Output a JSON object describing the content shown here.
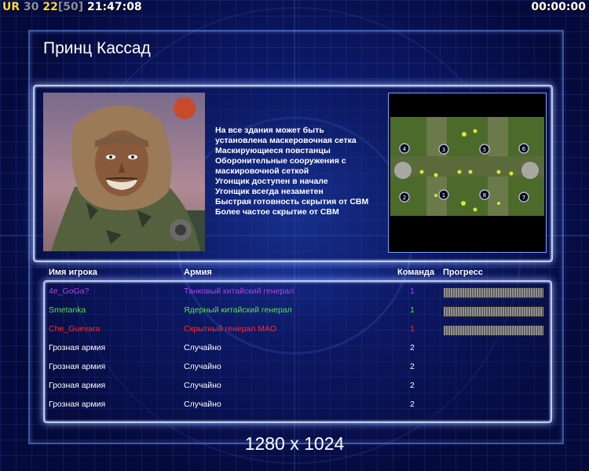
{
  "hud": {
    "tag": "UR",
    "value1": "30",
    "value2": "22",
    "value3": "[50]",
    "clock": "21:47:08",
    "timer": "00:00:00"
  },
  "title": "Принц Кассад",
  "description": [
    "На все здания может быть",
    " установлена маскеровочная сетка",
    "Маскирующиеся повстанцы",
    "Оборонительные сооружения с",
    " маскировочной сеткой",
    "Угонщик доступен в начале",
    "Угонщик всегда незаметен",
    "Быстрая готовность скрытия от СВМ",
    "Более частое скрытие от СВМ"
  ],
  "table": {
    "headers": {
      "player": "Имя игрока",
      "army": "Армия",
      "team": "Команда",
      "progress": "Прогресс"
    },
    "rows": [
      {
        "player": "4e_GoGa?",
        "army": "Танковый китайский генерал",
        "team": "1",
        "color": "#b040e8",
        "progress": 1
      },
      {
        "player": "Smetanka",
        "army": "Ядерный китайский генерал",
        "team": "1",
        "color": "#59e04a",
        "progress": 1
      },
      {
        "player": "Che_Guevara",
        "army": "Скрытный генерал МАО",
        "team": "1",
        "color": "#ff2a2a",
        "progress": 1
      },
      {
        "player": "Грозная армия",
        "army": "Случайно",
        "team": "2",
        "color": "#ffffff",
        "progress": null
      },
      {
        "player": "Грозная армия",
        "army": "Случайно",
        "team": "2",
        "color": "#ffffff",
        "progress": null
      },
      {
        "player": "Грозная армия",
        "army": "Случайно",
        "team": "2",
        "color": "#ffffff",
        "progress": null
      },
      {
        "player": "Грозная армия",
        "army": "Случайно",
        "team": "2",
        "color": "#ffffff",
        "progress": null
      }
    ]
  },
  "minimap": {
    "start_positions": [
      "1",
      "2",
      "3",
      "4",
      "5",
      "6",
      "7",
      "8"
    ]
  },
  "resolution": "1280 x 1024",
  "colors": {
    "frame": "#b8ccff",
    "background": "#06093a",
    "accent": "#ffd83a"
  }
}
